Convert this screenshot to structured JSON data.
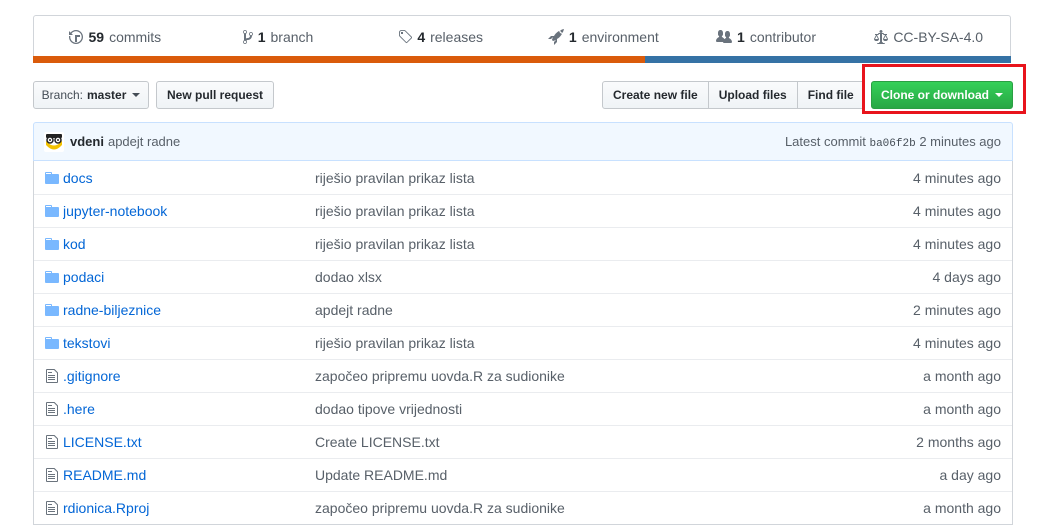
{
  "summary": {
    "commits": {
      "count": "59",
      "label": "commits"
    },
    "branches": {
      "count": "1",
      "label": "branch"
    },
    "releases": {
      "count": "4",
      "label": "releases"
    },
    "environments": {
      "count": "1",
      "label": "environment"
    },
    "contributors": {
      "count": "1",
      "label": "contributor"
    },
    "license": "CC-BY-SA-4.0",
    "language_colors": [
      "#da5b0b",
      "#3572a5"
    ]
  },
  "toolbar": {
    "branch_prefix": "Branch:",
    "branch_name": "master",
    "new_pr": "New pull request",
    "create_file": "Create new file",
    "upload_files": "Upload files",
    "find_file": "Find file",
    "clone": "Clone or download"
  },
  "commit": {
    "author": "vdeni",
    "message": "apdejt radne",
    "latest_label": "Latest commit",
    "sha": "ba06f2b",
    "age": "2 minutes ago"
  },
  "files": [
    {
      "type": "dir",
      "name": "docs",
      "message": "riješio pravilan prikaz lista",
      "age": "4 minutes ago"
    },
    {
      "type": "dir",
      "name": "jupyter-notebook",
      "message": "riješio pravilan prikaz lista",
      "age": "4 minutes ago"
    },
    {
      "type": "dir",
      "name": "kod",
      "message": "riješio pravilan prikaz lista",
      "age": "4 minutes ago"
    },
    {
      "type": "dir",
      "name": "podaci",
      "message": "dodao xlsx",
      "age": "4 days ago"
    },
    {
      "type": "dir",
      "name": "radne-biljeznice",
      "message": "apdejt radne",
      "age": "2 minutes ago"
    },
    {
      "type": "dir",
      "name": "tekstovi",
      "message": "riješio pravilan prikaz lista",
      "age": "4 minutes ago"
    },
    {
      "type": "file",
      "name": ".gitignore",
      "message": "započeo pripremu uovda.R za sudionike",
      "age": "a month ago"
    },
    {
      "type": "file",
      "name": ".here",
      "message": "dodao tipove vrijednosti",
      "age": "a month ago"
    },
    {
      "type": "file",
      "name": "LICENSE.txt",
      "message": "Create LICENSE.txt",
      "age": "2 months ago"
    },
    {
      "type": "file",
      "name": "README.md",
      "message": "Update README.md",
      "age": "a day ago"
    },
    {
      "type": "file",
      "name": "rdionica.Rproj",
      "message": "započeo pripremu uovda.R za sudionike",
      "age": "a month ago"
    }
  ]
}
